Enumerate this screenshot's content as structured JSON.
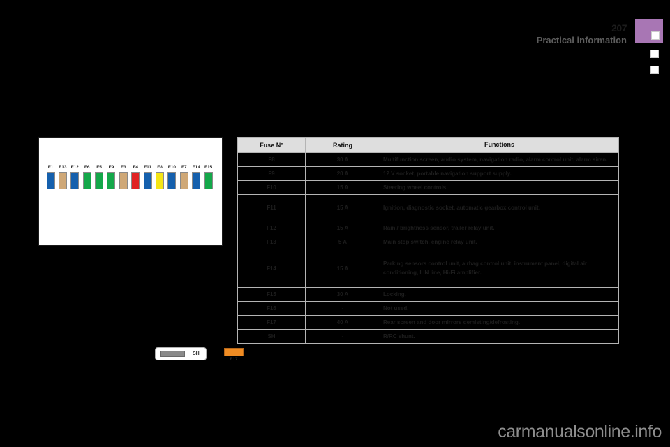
{
  "header": {
    "page_number": "207",
    "section_title": "Practical information",
    "tab_color": "#a876b4"
  },
  "fuse_diagram": {
    "fuses": [
      {
        "label": "F1",
        "color": "#1560ad"
      },
      {
        "label": "F13",
        "color": "#cfa877"
      },
      {
        "label": "F12",
        "color": "#1560ad"
      },
      {
        "label": "F6",
        "color": "#14a84a"
      },
      {
        "label": "F5",
        "color": "#14a84a"
      },
      {
        "label": "F9",
        "color": "#14a84a"
      },
      {
        "label": "F3",
        "color": "#cfa877"
      },
      {
        "label": "F4",
        "color": "#e02323"
      },
      {
        "label": "F11",
        "color": "#1560ad"
      },
      {
        "label": "F8",
        "color": "#f5e515"
      },
      {
        "label": "F10",
        "color": "#1560ad"
      },
      {
        "label": "F7",
        "color": "#cfa877"
      },
      {
        "label": "F14",
        "color": "#1560ad"
      },
      {
        "label": "F15",
        "color": "#14a84a"
      }
    ],
    "shunt_label": "SH",
    "f17_label": "F17",
    "f17_color": "#f08c23"
  },
  "table": {
    "headers": {
      "fuse": "Fuse N°",
      "rating": "Rating",
      "functions": "Functions"
    },
    "rows": [
      {
        "fuse": "F8",
        "rating": "30 A",
        "functions": "Multifunction screen, audio system, navigation radio, alarm control unit, alarm siren."
      },
      {
        "fuse": "F9",
        "rating": "20 A",
        "functions": "12 V socket, portable navigation support supply."
      },
      {
        "fuse": "F10",
        "rating": "15 A",
        "functions": "Steering wheel controls."
      },
      {
        "fuse": "F11",
        "rating": "15 A",
        "functions": "Ignition, diagnostic socket, automatic gearbox control unit."
      },
      {
        "fuse": "F12",
        "rating": "15 A",
        "functions": "Rain / brightness sensor, trailer relay unit."
      },
      {
        "fuse": "F13",
        "rating": "5 A",
        "functions": "Main stop switch, engine relay unit."
      },
      {
        "fuse": "F14",
        "rating": "15 A",
        "functions": "Parking sensors control unit, airbag control unit, instrument panel, digital air conditioning, LIN line, Hi-Fi amplifier."
      },
      {
        "fuse": "F15",
        "rating": "30 A",
        "functions": "Locking."
      },
      {
        "fuse": "F16",
        "rating": "-",
        "functions": "Not used."
      },
      {
        "fuse": "F17",
        "rating": "40 A",
        "functions": "Rear screen and door mirrors demisting/defrosting."
      },
      {
        "fuse": "SH",
        "rating": "-",
        "functions": "R/RC shunt."
      }
    ]
  },
  "footer": {
    "watermark": "carmanualsonline.info"
  }
}
